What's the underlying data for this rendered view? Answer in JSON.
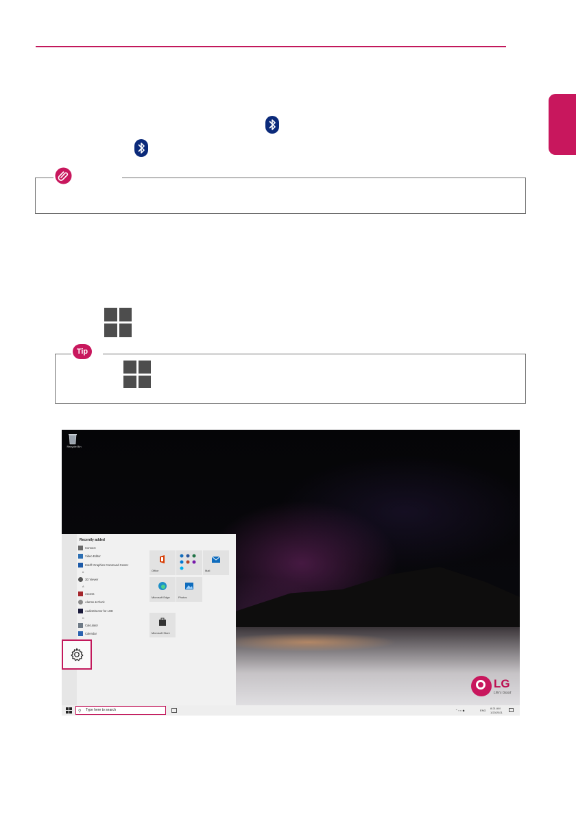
{
  "page": {
    "page_number": "",
    "accent_color": "#c2185b"
  },
  "note": {
    "icon": "paperclip-icon"
  },
  "tip": {
    "badge": "Tip"
  },
  "screenshot": {
    "desktop_icon": "Recycle Bin",
    "start_menu": {
      "heading": "Recently added",
      "items": [
        {
          "kind": "app",
          "label": "Connect"
        },
        {
          "kind": "app",
          "label": "Video Editor"
        },
        {
          "kind": "app",
          "label": "Intel® Graphics Command Center"
        },
        {
          "kind": "letter",
          "label": "#"
        },
        {
          "kind": "app",
          "label": "3D Viewer"
        },
        {
          "kind": "letter",
          "label": "A"
        },
        {
          "kind": "app",
          "label": "Access"
        },
        {
          "kind": "app",
          "label": "Alarms & Clock"
        },
        {
          "kind": "app",
          "label": "AudioDirector for LGE"
        },
        {
          "kind": "letter",
          "label": "C"
        },
        {
          "kind": "app",
          "label": "Calculator"
        },
        {
          "kind": "app",
          "label": "Calendar"
        }
      ],
      "tiles": [
        {
          "label": "Office"
        },
        {
          "label": ""
        },
        {
          "label": "Mail"
        },
        {
          "label": "Microsoft Edge"
        },
        {
          "label": "Photos"
        },
        {
          "label": "Microsoft Store"
        }
      ]
    },
    "settings_icon": "gear-icon",
    "search_placeholder": "Type here to search",
    "tray": {
      "lang": "ENG",
      "time": "8:21 AM",
      "date": "1/20/2021"
    },
    "brand": {
      "name": "LG",
      "tagline": "Life's Good"
    }
  }
}
